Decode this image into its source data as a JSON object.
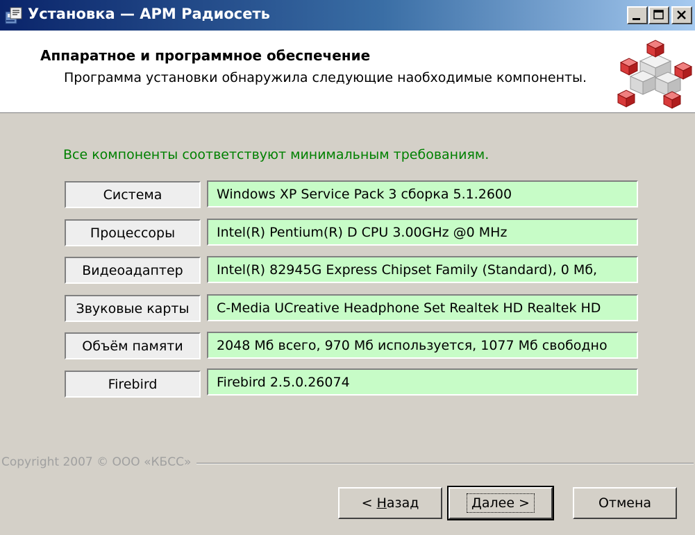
{
  "window": {
    "title": "Установка — АРМ Радиосеть",
    "controls": {
      "minimize": "minimize-icon",
      "maximize": "maximize-icon",
      "close": "close-icon"
    }
  },
  "header": {
    "title": "Аппаратное и программное обеспечение",
    "subtitle": "Программа установки обнаружила следующие наобходимые компоненты.",
    "graphic_icon": "cubes-graphic"
  },
  "status": {
    "text": "Все компоненты соответствуют минимальным требованиям.",
    "color": "#008000"
  },
  "components": [
    {
      "label": "Система",
      "value": "Windows XP Service Pack 3 сборка 5.1.2600"
    },
    {
      "label": "Процессоры",
      "value": "Intel(R) Pentium(R) D CPU 3.00GHz @0 MHz"
    },
    {
      "label": "Видеоадаптер",
      "value": "Intel(R) 82945G Express Chipset Family (Standard), 0 Мб,"
    },
    {
      "label": "Звуковые карты",
      "value": "C-Media UCreative Headphone Set   Realtek HD Realtek HD"
    },
    {
      "label": "Объём памяти",
      "value": "2048 Мб всего, 970 Мб используется, 1077 Мб свободно"
    },
    {
      "label": "Firebird",
      "value": "Firebird 2.5.0.26074"
    }
  ],
  "footer": {
    "copyright": "Copyright 2007 © ООО «КБСС»"
  },
  "buttons": {
    "back": {
      "prefix": "< ",
      "mnemonic": "Н",
      "rest": "азад"
    },
    "next": {
      "mnemonic": "Д",
      "rest": "алее >"
    },
    "cancel": "Отмена"
  },
  "colors": {
    "title_gradient_start": "#0a246a",
    "title_gradient_end": "#a6caf0",
    "value_bg": "#c7fcc7",
    "dialog_bg": "#d4d0c8"
  }
}
